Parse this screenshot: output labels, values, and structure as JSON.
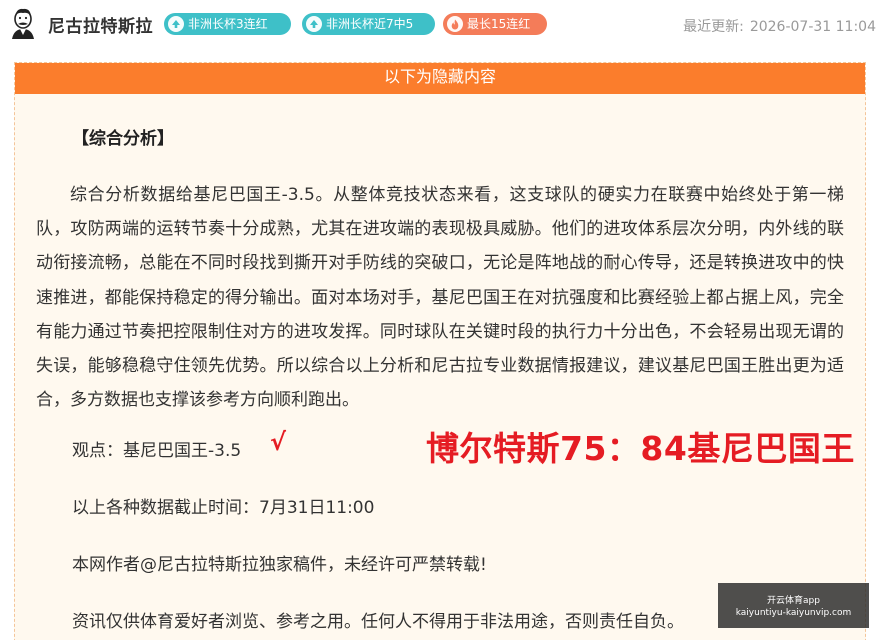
{
  "header": {
    "author": "尼古拉特斯拉",
    "avatar_icon": "sketch-portrait-avatar",
    "tags": [
      {
        "label": "非洲长杯3连红",
        "icon": "arrow-up-icon",
        "color": "#3ec0c8"
      },
      {
        "label": "非洲长杯近7中5",
        "icon": "arrow-up-icon",
        "color": "#3ec0c8"
      },
      {
        "label": "最长15连红",
        "icon": "fire-icon",
        "color": "#f47c59"
      }
    ],
    "updated_label": "最近更新:",
    "updated_time": "2026-07-31 11:04"
  },
  "hidden": {
    "banner": "以下为隐藏内容",
    "banner_color": "#fb7d2c"
  },
  "article": {
    "section_title": "【综合分析】",
    "paragraph": "综合分析数据给基尼巴国王-3.5。从整体竞技状态来看，这支球队的硬实力在联赛中始终处于第一梯队，攻防两端的运转节奏十分成熟，尤其在进攻端的表现极具威胁。他们的进攻体系层次分明，内外线的联动衔接流畅，总能在不同时段找到撕开对手防线的突破口，无论是阵地战的耐心传导，还是转换进攻中的快速推进，都能保持稳定的得分输出。面对本场对手，基尼巴国王在对抗强度和比赛经验上都占据上风，完全有能力通过节奏把控限制住对方的进攻发挥。同时球队在关键时段的执行力十分出色，不会轻易出现无谓的失误，能够稳稳守住领先优势。所以综合以上分析和尼古拉专业数据情报建议，建议基尼巴国王胜出更为适合，多方数据也支撑该参考方向顺利跑出。",
    "viewpoint": "观点：基尼巴国王-3.5",
    "check_mark": "√",
    "result": "博尔特斯75：84基尼巴国王",
    "result_color": "#e51c23",
    "cutoff": "以上各种数据截止时间：7月31日11:00",
    "copyright": "本网作者@尼古拉特斯拉独家稿件，未经许可严禁转载!",
    "disclaimer": "资讯仅供体育爱好者浏览、参考之用。任何人不得用于非法用途，否则责任自负。"
  },
  "watermark": {
    "line1": "开云体育app",
    "line2": "kaiyuntiyu-kaiyunvip.com"
  }
}
